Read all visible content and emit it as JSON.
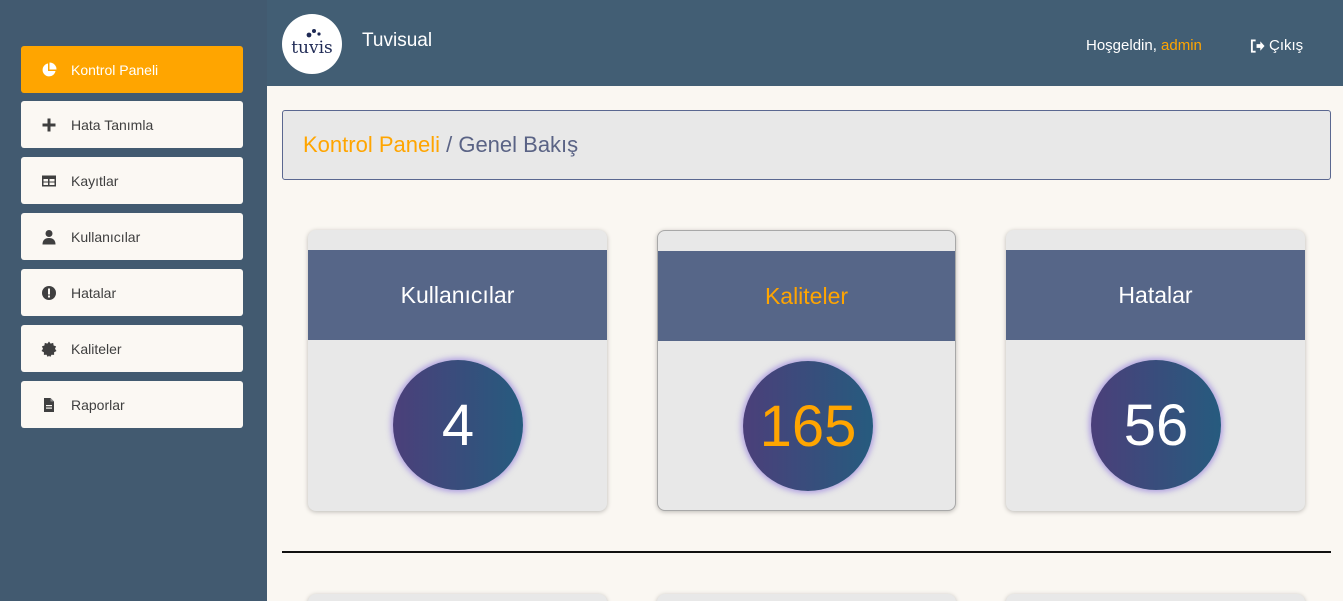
{
  "sidebar": {
    "items": [
      {
        "label": "Kontrol Paneli",
        "icon": "pie-chart-icon"
      },
      {
        "label": "Hata Tanımla",
        "icon": "plus-icon"
      },
      {
        "label": "Kayıtlar",
        "icon": "table-icon"
      },
      {
        "label": "Kullanıcılar",
        "icon": "user-icon"
      },
      {
        "label": "Hatalar",
        "icon": "exclamation-circle-icon"
      },
      {
        "label": "Kaliteler",
        "icon": "certificate-icon"
      },
      {
        "label": "Raporlar",
        "icon": "file-icon"
      }
    ],
    "active_index": 0
  },
  "header": {
    "logo_text": "tuvis",
    "brand": "Tuvisual",
    "welcome_prefix": "Hoşgeldin, ",
    "username": "admin",
    "logout_label": "Çıkış"
  },
  "breadcrumb": {
    "first": "Kontrol Paneli",
    "separator": " / ",
    "second": "Genel Bakış"
  },
  "cards": [
    {
      "title": "Kullanıcılar",
      "value": "4"
    },
    {
      "title": "Kaliteler",
      "value": "165"
    },
    {
      "title": "Hatalar",
      "value": "56"
    }
  ],
  "colors": {
    "accent": "#ffa500",
    "sidebar_bg": "#425a70",
    "header_bg": "#425e74",
    "card_header_bg": "#566688"
  }
}
